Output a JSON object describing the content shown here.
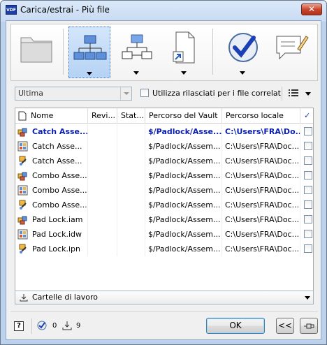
{
  "window": {
    "title": "Carica/estrai - Più file",
    "app_icon_text": "VDF",
    "close_label": "✕"
  },
  "toolbar": {
    "buttons": [
      {
        "name": "folder",
        "icon": "folder-icon",
        "has_dropdown": false,
        "active": false
      },
      {
        "name": "structure",
        "icon": "structure-tree-icon",
        "has_dropdown": true,
        "active": true
      },
      {
        "name": "structure-alt",
        "icon": "structure-tree-outline-icon",
        "has_dropdown": true,
        "active": false
      },
      {
        "name": "document-link",
        "icon": "document-shortcut-icon",
        "has_dropdown": true,
        "active": false
      },
      {
        "name": "check-in",
        "icon": "check-circle-icon",
        "has_dropdown": true,
        "active": false
      },
      {
        "name": "comment",
        "icon": "comment-edit-icon",
        "has_dropdown": false,
        "active": false
      }
    ]
  },
  "options": {
    "version_select": "Ultima",
    "use_released_label": "Utilizza rilasciati per i file correlati",
    "use_released_checked": false
  },
  "table": {
    "columns": [
      "Nome",
      "Revi...",
      "Stat...",
      "Percorso del Vault",
      "Percorso locale",
      "✓"
    ],
    "rows": [
      {
        "name": "Catch Asse...",
        "rev": "",
        "status": "",
        "vault": "$/Padlock/Asse...",
        "local": "C:\\Users\\FRA\\Do...",
        "bold": true,
        "icon": "assembly-icon"
      },
      {
        "name": "Catch Asse...",
        "rev": "",
        "status": "",
        "vault": "$/Padlock/Assem...",
        "local": "C:\\Users\\FRA\\Doc...",
        "bold": false,
        "icon": "drawing-icon"
      },
      {
        "name": "Catch Asse...",
        "rev": "",
        "status": "",
        "vault": "$/Padlock/Assem...",
        "local": "C:\\Users\\FRA\\Doc...",
        "bold": false,
        "icon": "presentation-icon"
      },
      {
        "name": "Combo Asse...",
        "rev": "",
        "status": "",
        "vault": "$/Padlock/Assem...",
        "local": "C:\\Users\\FRA\\Doc...",
        "bold": false,
        "icon": "assembly-icon"
      },
      {
        "name": "Combo Asse...",
        "rev": "",
        "status": "",
        "vault": "$/Padlock/Assem...",
        "local": "C:\\Users\\FRA\\Doc...",
        "bold": false,
        "icon": "drawing-icon"
      },
      {
        "name": "Combo Asse...",
        "rev": "",
        "status": "",
        "vault": "$/Padlock/Assem...",
        "local": "C:\\Users\\FRA\\Doc...",
        "bold": false,
        "icon": "presentation-icon"
      },
      {
        "name": "Pad Lock.iam",
        "rev": "",
        "status": "",
        "vault": "$/Padlock/Assem...",
        "local": "C:\\Users\\FRA\\Doc...",
        "bold": false,
        "icon": "assembly-icon"
      },
      {
        "name": "Pad Lock.idw",
        "rev": "",
        "status": "",
        "vault": "$/Padlock/Assem...",
        "local": "C:\\Users\\FRA\\Doc...",
        "bold": false,
        "icon": "drawing-icon"
      },
      {
        "name": "Pad Lock.ipn",
        "rev": "",
        "status": "",
        "vault": "$/Padlock/Assem...",
        "local": "C:\\Users\\FRA\\Doc...",
        "bold": false,
        "icon": "presentation-icon"
      }
    ]
  },
  "folder_select": "Cartelle di lavoro",
  "status": {
    "help": "?",
    "checkin_count": "0",
    "download_count": "9",
    "ok_label": "OK",
    "collapse_label": "<<"
  }
}
